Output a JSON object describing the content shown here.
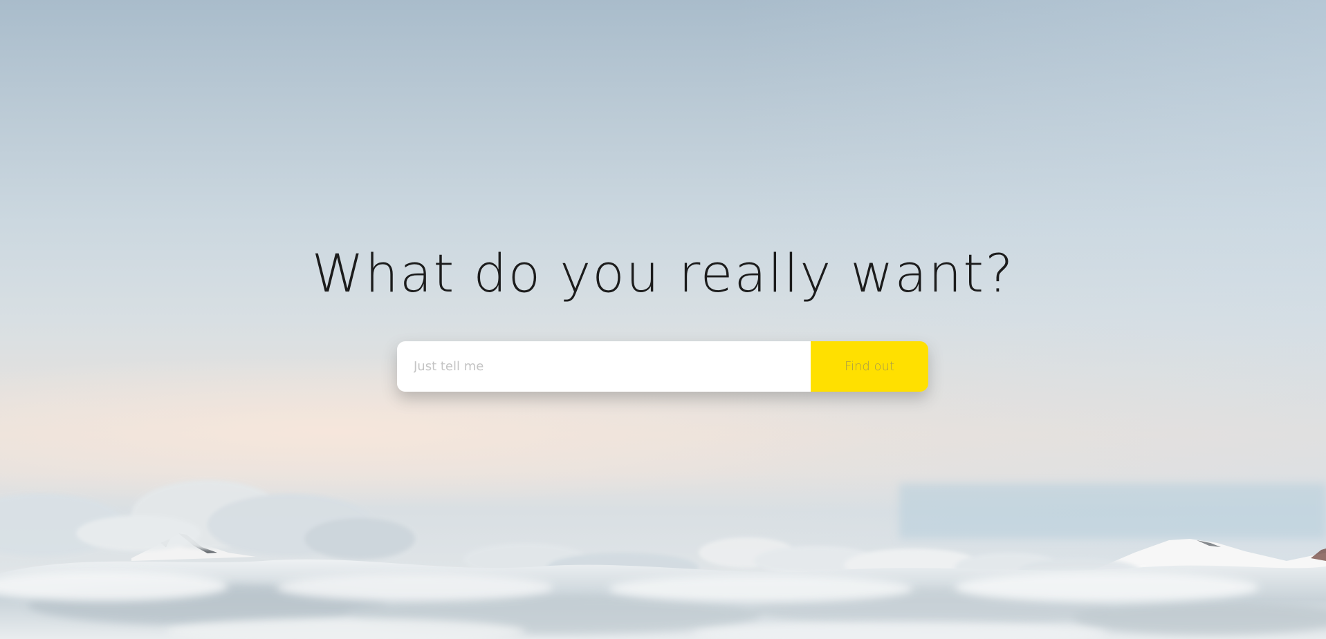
{
  "hero": {
    "headline": "What do you really want?"
  },
  "search": {
    "placeholder": "Just tell me",
    "value": "",
    "button_label": "Find out"
  },
  "colors": {
    "accent": "#ffe000",
    "headline_text": "#1c1c1c",
    "input_background": "#ffffff",
    "placeholder_text": "#c4c4c4"
  },
  "background": {
    "image": "clouds-above-snowy-mountain-peaks"
  }
}
